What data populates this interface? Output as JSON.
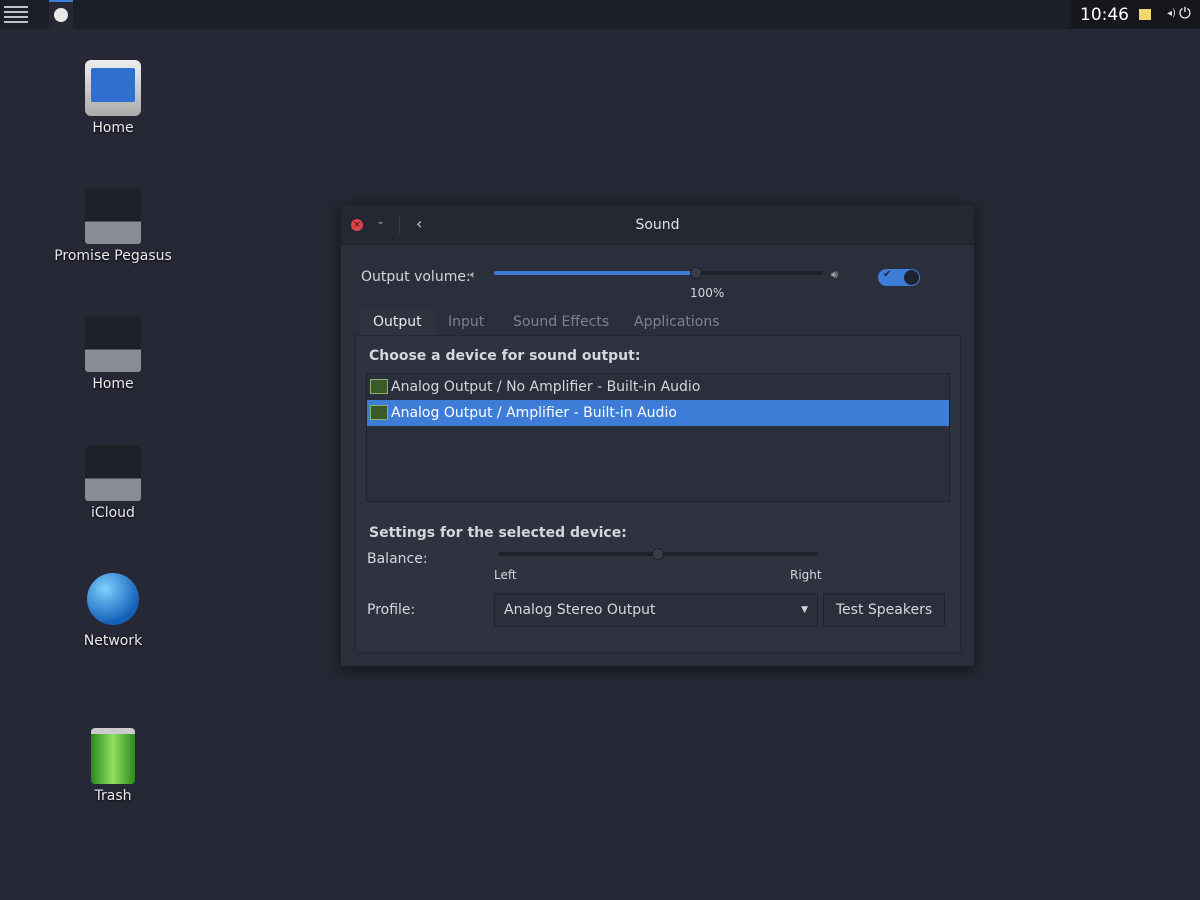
{
  "topbar": {
    "menu_icon": "hamburger-icon",
    "app_icon": "sound-knob-icon",
    "clock": "10:46",
    "notes_icon": "sticky-note-icon",
    "volume_icon": "speaker-icon",
    "power_icon": "power-icon"
  },
  "desktop": {
    "icons": [
      {
        "label": "Home",
        "icon": "monitor-icon"
      },
      {
        "label": "Promise Pegasus",
        "icon": "drive-icon"
      },
      {
        "label": "Home",
        "icon": "drive-icon"
      },
      {
        "label": "iCloud",
        "icon": "drive-icon"
      },
      {
        "label": "Network",
        "icon": "globe-icon"
      },
      {
        "label": "Trash",
        "icon": "trash-icon"
      }
    ]
  },
  "window": {
    "title": "Sound",
    "minimize": "-",
    "output_volume_label": "Output volume:",
    "volume_percent_text": "100%",
    "volume_value": 100,
    "volume_max": 163,
    "mute_toggle_on": true,
    "tabs": [
      {
        "label": "Output"
      },
      {
        "label": "Input"
      },
      {
        "label": "Sound Effects"
      },
      {
        "label": "Applications"
      }
    ],
    "active_tab": "Output",
    "device_header": "Choose a device for sound output:",
    "devices": [
      {
        "label": "Analog Output / No Amplifier - Built-in Audio",
        "selected": false
      },
      {
        "label": "Analog Output / Amplifier - Built-in Audio",
        "selected": true
      }
    ],
    "settings_header": "Settings for the selected device:",
    "balance_label": "Balance:",
    "balance_left": "Left",
    "balance_right": "Right",
    "balance_value": 0.5,
    "profile_label": "Profile:",
    "profile_value": "Analog Stereo Output",
    "test_button": "Test Speakers"
  },
  "colors": {
    "accent": "#3d7dd8",
    "close": "#d9434a"
  }
}
